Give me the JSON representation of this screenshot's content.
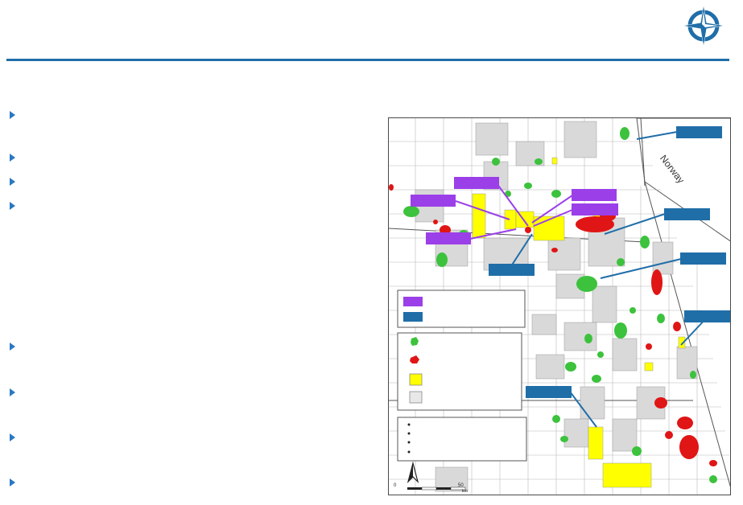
{
  "map": {
    "country_label": "Norway",
    "scale_label_mid": "50",
    "scale_label_start": "0",
    "scale_unit": "km",
    "colors": {
      "purple_callout": "#9b3fe8",
      "blue_callout": "#1f6ea8",
      "oil_field": "#3cc23c",
      "gas_field": "#e01515",
      "licence_yellow": "#ffff00",
      "licence_grey": "#d9d9d9"
    }
  },
  "icons": {
    "logo": "compass-star-icon",
    "bullet": "triangle-bullet-icon",
    "north_arrow": "north-arrow-icon"
  }
}
